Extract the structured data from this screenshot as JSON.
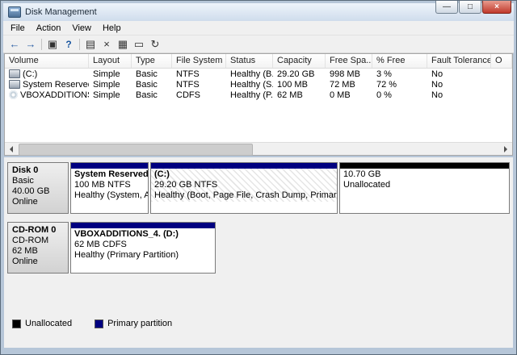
{
  "window": {
    "title": "Disk Management",
    "controls": [
      {
        "name": "minimize",
        "glyph": "—"
      },
      {
        "name": "maximize",
        "glyph": "□"
      },
      {
        "name": "close",
        "glyph": "×"
      }
    ]
  },
  "menu": {
    "items": [
      {
        "label": "File"
      },
      {
        "label": "Action"
      },
      {
        "label": "View"
      },
      {
        "label": "Help"
      }
    ]
  },
  "toolbar": {
    "icons": [
      {
        "name": "back-icon",
        "glyph": "←"
      },
      {
        "name": "forward-icon",
        "glyph": "→"
      },
      {
        "name": "show-console-tree-icon",
        "glyph": "▣"
      },
      {
        "name": "help-icon",
        "glyph": "?"
      },
      {
        "name": "export-list-icon",
        "glyph": "▤"
      },
      {
        "name": "delete-icon",
        "glyph": "×"
      },
      {
        "name": "properties-icon",
        "glyph": "▦"
      },
      {
        "name": "open-folder-icon",
        "glyph": "▭"
      },
      {
        "name": "refresh-icon",
        "glyph": "↻"
      }
    ]
  },
  "table": {
    "columns": [
      "Volume",
      "Layout",
      "Type",
      "File System",
      "Status",
      "Capacity",
      "Free Spa...",
      "% Free",
      "Fault Tolerance",
      "O"
    ],
    "rows": [
      {
        "volume": "(C:)",
        "layout": "Simple",
        "type": "Basic",
        "fs": "NTFS",
        "status": "Healthy (B...",
        "capacity": "29.20 GB",
        "free": "998 MB",
        "pct": "3 %",
        "fault": "No",
        "overhead": ""
      },
      {
        "volume": "System Reserved",
        "layout": "Simple",
        "type": "Basic",
        "fs": "NTFS",
        "status": "Healthy (S...",
        "capacity": "100 MB",
        "free": "72 MB",
        "pct": "72 %",
        "fault": "No",
        "overhead": ""
      },
      {
        "volume": "VBOXADDITIONS_...",
        "layout": "Simple",
        "type": "Basic",
        "fs": "CDFS",
        "status": "Healthy (P...",
        "capacity": "62 MB",
        "free": "0 MB",
        "pct": "0 %",
        "fault": "No",
        "overhead": ""
      }
    ]
  },
  "disks": [
    {
      "name": "Disk 0",
      "type": "Basic",
      "size": "40.00 GB",
      "status": "Online",
      "partitions": [
        {
          "name": "System Reserved",
          "detail": "100 MB NTFS",
          "status": "Healthy (System, Activ"
        },
        {
          "name": "(C:)",
          "detail": "29.20 GB NTFS",
          "status": "Healthy (Boot, Page File, Crash Dump, Primary Partitio"
        }
      ],
      "unallocated": {
        "size": "10.70 GB",
        "label": "Unallocated"
      }
    },
    {
      "name": "CD-ROM 0",
      "type": "CD-ROM",
      "size": "62 MB",
      "status": "Online",
      "partitions": [
        {
          "name": "VBOXADDITIONS_4. (D:)",
          "detail": "62 MB CDFS",
          "status": "Healthy (Primary Partition)"
        }
      ]
    }
  ],
  "legend": [
    {
      "label": "Unallocated",
      "color": "#000000"
    },
    {
      "label": "Primary partition",
      "color": "#000080"
    }
  ],
  "colors": {
    "primary_partition": "#000080",
    "unallocated": "#000000"
  }
}
